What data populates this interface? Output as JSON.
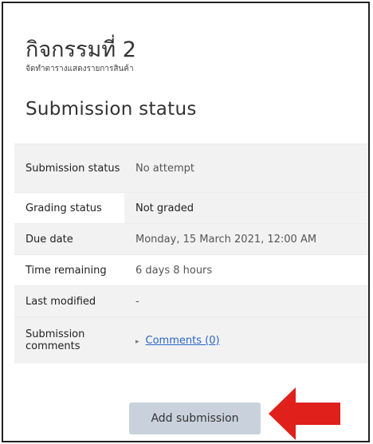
{
  "page": {
    "title": "กิจกรรมที่ 2",
    "description": "จัดทำตารางแสดงรายการสินค้า"
  },
  "submission": {
    "heading": "Submission status",
    "rows": [
      {
        "label": "Submission status",
        "value": "No attempt"
      },
      {
        "label": "Grading status",
        "value": "Not graded"
      },
      {
        "label": "Due date",
        "value": "Monday, 15 March 2021, 12:00 AM"
      },
      {
        "label": "Time remaining",
        "value": "6 days 8 hours"
      },
      {
        "label": "Last modified",
        "value": "-"
      },
      {
        "label": "Submission comments",
        "toggle": "▸",
        "link": "Comments (0)"
      }
    ],
    "button_label": "Add submission"
  },
  "colors": {
    "arrow": "#e0201b",
    "button_bg": "#c9d2dc",
    "link": "#2a64c8"
  },
  "icons": {
    "comments_toggle": "triangle-right-icon",
    "pointer": "red-arrow-icon"
  }
}
